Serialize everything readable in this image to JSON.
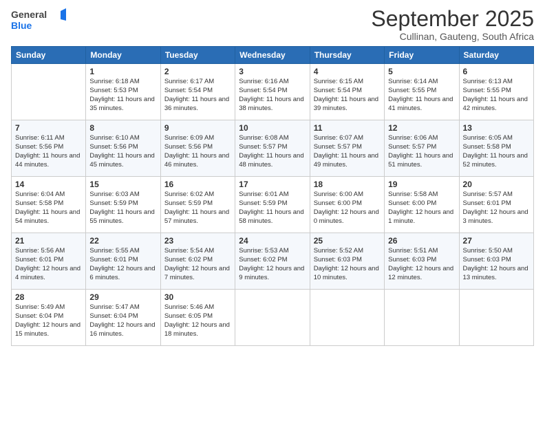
{
  "header": {
    "logo_general": "General",
    "logo_blue": "Blue",
    "month": "September 2025",
    "location": "Cullinan, Gauteng, South Africa"
  },
  "weekdays": [
    "Sunday",
    "Monday",
    "Tuesday",
    "Wednesday",
    "Thursday",
    "Friday",
    "Saturday"
  ],
  "weeks": [
    [
      {
        "day": "",
        "sunrise": "",
        "sunset": "",
        "daylight": ""
      },
      {
        "day": "1",
        "sunrise": "Sunrise: 6:18 AM",
        "sunset": "Sunset: 5:53 PM",
        "daylight": "Daylight: 11 hours and 35 minutes."
      },
      {
        "day": "2",
        "sunrise": "Sunrise: 6:17 AM",
        "sunset": "Sunset: 5:54 PM",
        "daylight": "Daylight: 11 hours and 36 minutes."
      },
      {
        "day": "3",
        "sunrise": "Sunrise: 6:16 AM",
        "sunset": "Sunset: 5:54 PM",
        "daylight": "Daylight: 11 hours and 38 minutes."
      },
      {
        "day": "4",
        "sunrise": "Sunrise: 6:15 AM",
        "sunset": "Sunset: 5:54 PM",
        "daylight": "Daylight: 11 hours and 39 minutes."
      },
      {
        "day": "5",
        "sunrise": "Sunrise: 6:14 AM",
        "sunset": "Sunset: 5:55 PM",
        "daylight": "Daylight: 11 hours and 41 minutes."
      },
      {
        "day": "6",
        "sunrise": "Sunrise: 6:13 AM",
        "sunset": "Sunset: 5:55 PM",
        "daylight": "Daylight: 11 hours and 42 minutes."
      }
    ],
    [
      {
        "day": "7",
        "sunrise": "Sunrise: 6:11 AM",
        "sunset": "Sunset: 5:56 PM",
        "daylight": "Daylight: 11 hours and 44 minutes."
      },
      {
        "day": "8",
        "sunrise": "Sunrise: 6:10 AM",
        "sunset": "Sunset: 5:56 PM",
        "daylight": "Daylight: 11 hours and 45 minutes."
      },
      {
        "day": "9",
        "sunrise": "Sunrise: 6:09 AM",
        "sunset": "Sunset: 5:56 PM",
        "daylight": "Daylight: 11 hours and 46 minutes."
      },
      {
        "day": "10",
        "sunrise": "Sunrise: 6:08 AM",
        "sunset": "Sunset: 5:57 PM",
        "daylight": "Daylight: 11 hours and 48 minutes."
      },
      {
        "day": "11",
        "sunrise": "Sunrise: 6:07 AM",
        "sunset": "Sunset: 5:57 PM",
        "daylight": "Daylight: 11 hours and 49 minutes."
      },
      {
        "day": "12",
        "sunrise": "Sunrise: 6:06 AM",
        "sunset": "Sunset: 5:57 PM",
        "daylight": "Daylight: 11 hours and 51 minutes."
      },
      {
        "day": "13",
        "sunrise": "Sunrise: 6:05 AM",
        "sunset": "Sunset: 5:58 PM",
        "daylight": "Daylight: 11 hours and 52 minutes."
      }
    ],
    [
      {
        "day": "14",
        "sunrise": "Sunrise: 6:04 AM",
        "sunset": "Sunset: 5:58 PM",
        "daylight": "Daylight: 11 hours and 54 minutes."
      },
      {
        "day": "15",
        "sunrise": "Sunrise: 6:03 AM",
        "sunset": "Sunset: 5:59 PM",
        "daylight": "Daylight: 11 hours and 55 minutes."
      },
      {
        "day": "16",
        "sunrise": "Sunrise: 6:02 AM",
        "sunset": "Sunset: 5:59 PM",
        "daylight": "Daylight: 11 hours and 57 minutes."
      },
      {
        "day": "17",
        "sunrise": "Sunrise: 6:01 AM",
        "sunset": "Sunset: 5:59 PM",
        "daylight": "Daylight: 11 hours and 58 minutes."
      },
      {
        "day": "18",
        "sunrise": "Sunrise: 6:00 AM",
        "sunset": "Sunset: 6:00 PM",
        "daylight": "Daylight: 12 hours and 0 minutes."
      },
      {
        "day": "19",
        "sunrise": "Sunrise: 5:58 AM",
        "sunset": "Sunset: 6:00 PM",
        "daylight": "Daylight: 12 hours and 1 minute."
      },
      {
        "day": "20",
        "sunrise": "Sunrise: 5:57 AM",
        "sunset": "Sunset: 6:01 PM",
        "daylight": "Daylight: 12 hours and 3 minutes."
      }
    ],
    [
      {
        "day": "21",
        "sunrise": "Sunrise: 5:56 AM",
        "sunset": "Sunset: 6:01 PM",
        "daylight": "Daylight: 12 hours and 4 minutes."
      },
      {
        "day": "22",
        "sunrise": "Sunrise: 5:55 AM",
        "sunset": "Sunset: 6:01 PM",
        "daylight": "Daylight: 12 hours and 6 minutes."
      },
      {
        "day": "23",
        "sunrise": "Sunrise: 5:54 AM",
        "sunset": "Sunset: 6:02 PM",
        "daylight": "Daylight: 12 hours and 7 minutes."
      },
      {
        "day": "24",
        "sunrise": "Sunrise: 5:53 AM",
        "sunset": "Sunset: 6:02 PM",
        "daylight": "Daylight: 12 hours and 9 minutes."
      },
      {
        "day": "25",
        "sunrise": "Sunrise: 5:52 AM",
        "sunset": "Sunset: 6:03 PM",
        "daylight": "Daylight: 12 hours and 10 minutes."
      },
      {
        "day": "26",
        "sunrise": "Sunrise: 5:51 AM",
        "sunset": "Sunset: 6:03 PM",
        "daylight": "Daylight: 12 hours and 12 minutes."
      },
      {
        "day": "27",
        "sunrise": "Sunrise: 5:50 AM",
        "sunset": "Sunset: 6:03 PM",
        "daylight": "Daylight: 12 hours and 13 minutes."
      }
    ],
    [
      {
        "day": "28",
        "sunrise": "Sunrise: 5:49 AM",
        "sunset": "Sunset: 6:04 PM",
        "daylight": "Daylight: 12 hours and 15 minutes."
      },
      {
        "day": "29",
        "sunrise": "Sunrise: 5:47 AM",
        "sunset": "Sunset: 6:04 PM",
        "daylight": "Daylight: 12 hours and 16 minutes."
      },
      {
        "day": "30",
        "sunrise": "Sunrise: 5:46 AM",
        "sunset": "Sunset: 6:05 PM",
        "daylight": "Daylight: 12 hours and 18 minutes."
      },
      {
        "day": "",
        "sunrise": "",
        "sunset": "",
        "daylight": ""
      },
      {
        "day": "",
        "sunrise": "",
        "sunset": "",
        "daylight": ""
      },
      {
        "day": "",
        "sunrise": "",
        "sunset": "",
        "daylight": ""
      },
      {
        "day": "",
        "sunrise": "",
        "sunset": "",
        "daylight": ""
      }
    ]
  ]
}
